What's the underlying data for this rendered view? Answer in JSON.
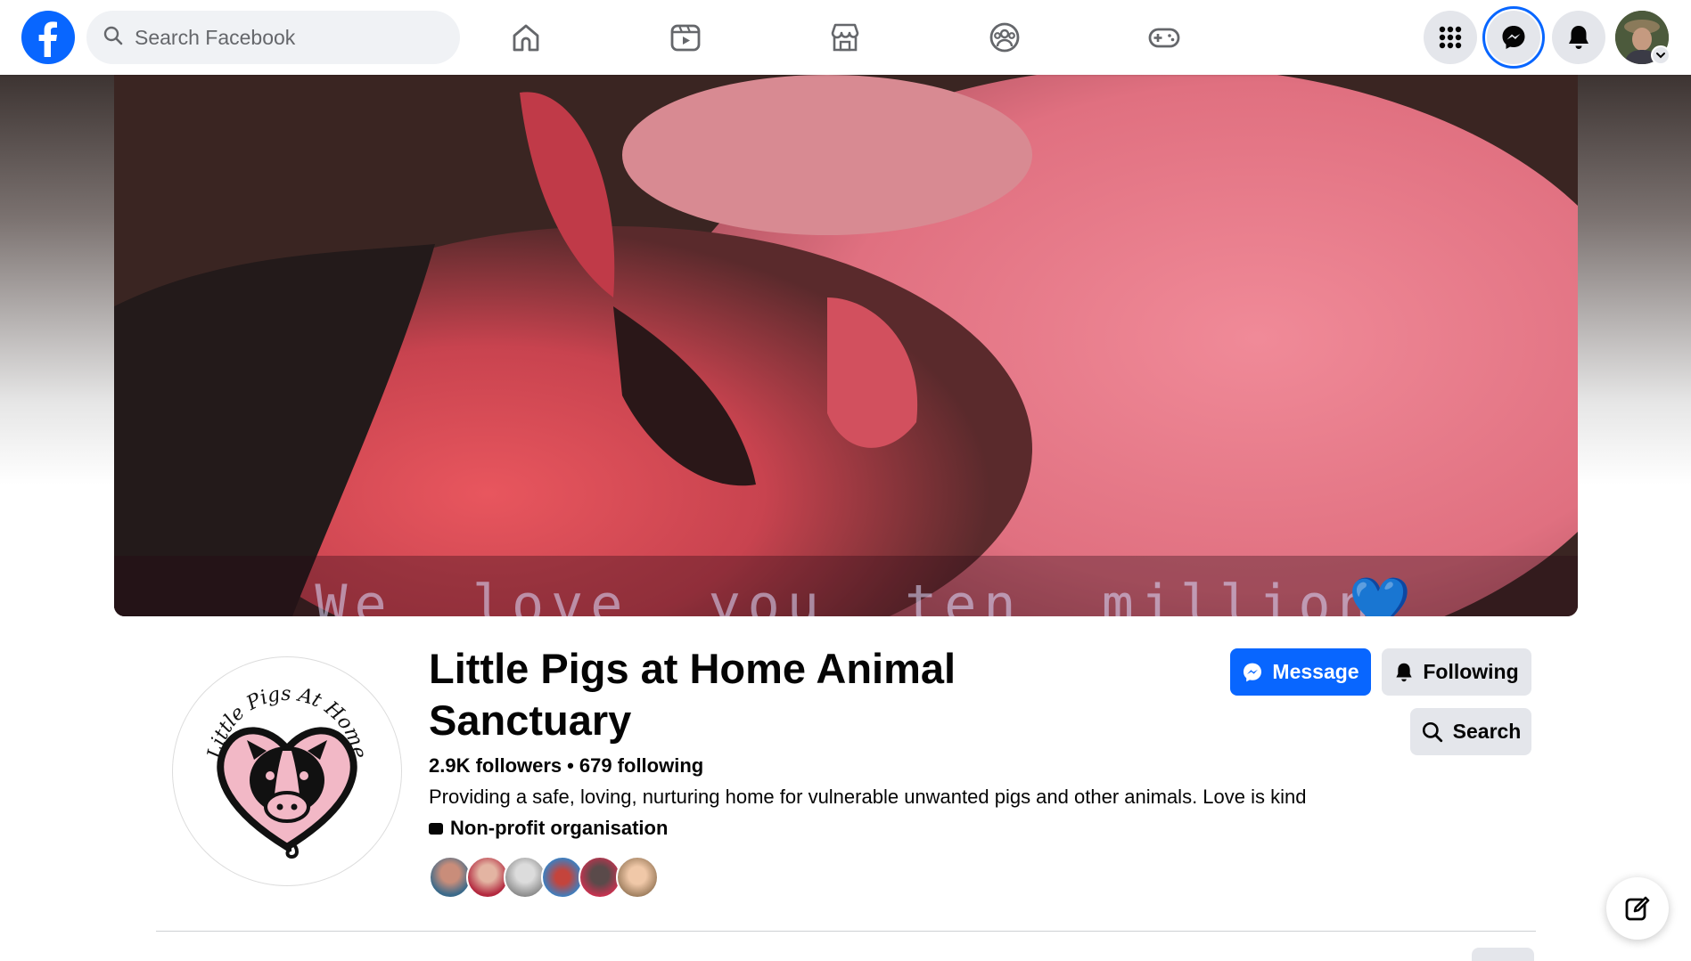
{
  "topbar": {
    "logo_icon": "facebook-logo-icon",
    "search_placeholder": "Search Facebook",
    "nav_icons": [
      "home-icon",
      "video-icon",
      "marketplace-icon",
      "groups-icon",
      "gaming-icon"
    ],
    "right_icons": [
      "menu-grid-icon",
      "messenger-icon",
      "notifications-bell-icon",
      "account-avatar"
    ],
    "accent_color": "#0866ff"
  },
  "cover": {
    "caption": "We  love  you  ten  million",
    "caption_hearts": "💙"
  },
  "profile": {
    "title": "Little Pigs at Home Animal Sanctuary",
    "logo_text": "Little Pigs At Home",
    "followers": "2.9K followers",
    "separator": "•",
    "following": "679 following",
    "bio": "Providing a safe, loving, nurturing home for vulnerable unwanted pigs and other animals. Love is kind",
    "category": "Non-profit organisation",
    "friend_avatar_count": 6
  },
  "actions": {
    "message_label": "Message",
    "following_label": "Following",
    "search_label": "Search"
  },
  "floating": {
    "compose_icon": "new-message-compose-icon"
  }
}
